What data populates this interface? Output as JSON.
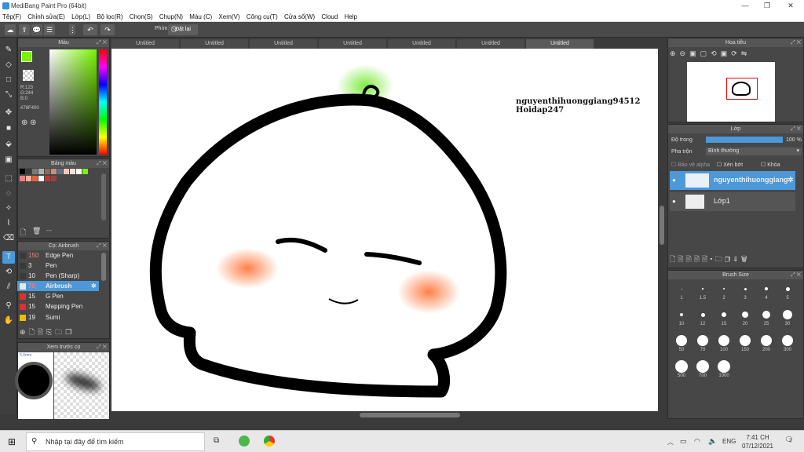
{
  "window": {
    "title": "MediBang Paint Pro (64bit)"
  },
  "menu": [
    "Tệp(F)",
    "Chỉnh sửa(E)",
    "Lớp(L)",
    "Bộ lọc(R)",
    "Chọn(S)",
    "Chụp(N)",
    "Màu (C)",
    "Xem(V)",
    "Công cụ(T)",
    "Cửa sổ(W)",
    "Cloud",
    "Help"
  ],
  "toolbar": {
    "shortcut_label": "Phím",
    "reset_label": "Đặt lại"
  },
  "color_panel": {
    "title": "Màu",
    "r": "R:123",
    "g": "G:244",
    "b": "B:0",
    "hex": "#78F400",
    "fg_color": "#78f400",
    "bg_color": "#000000"
  },
  "palette_panel": {
    "title": "Bảng màu",
    "name": "---"
  },
  "brush_panel": {
    "title": "Cọ: Airbrush",
    "items": [
      {
        "size": "150",
        "name": "Edge Pen",
        "color": "#3a3a3a"
      },
      {
        "size": "3",
        "name": "Pen",
        "color": "#3a3a3a"
      },
      {
        "size": "10",
        "name": "Pen (Sharp)",
        "color": "#3a3a3a"
      },
      {
        "size": "70",
        "name": "Airbrush",
        "color": "#e8e8e8"
      },
      {
        "size": "15",
        "name": "G Pen",
        "color": "#e03030"
      },
      {
        "size": "15",
        "name": "Mapping Pen",
        "color": "#e03030"
      },
      {
        "size": "19",
        "name": "Sumi",
        "color": "#e8c000"
      }
    ]
  },
  "preview_panel": {
    "title": "Xem trước cọ",
    "label": "5.0mm"
  },
  "tabs": [
    "Untitled",
    "Untitled",
    "Untitled",
    "Untitled",
    "Untitled",
    "Untitled",
    "Untitled"
  ],
  "canvas": {
    "watermark_line1": "nguyenthihuonggiang94512",
    "watermark_line2": "Hoidap247"
  },
  "navigator": {
    "title": "Hoa tiêu"
  },
  "layers_panel": {
    "title": "Lớp",
    "opacity_label": "Độ trong",
    "opacity_value": "100 %",
    "opacity_fraction": 1.0,
    "blend_label": "Pha trộn",
    "blend_value": "Bình thường",
    "protect_alpha": "Bảo vệ alpha",
    "clipping": "Xén bớt",
    "lock": "Khóa",
    "layers": [
      {
        "name": "nguyenthihuonggiang",
        "selected": true
      },
      {
        "name": "Lớp1",
        "selected": false
      }
    ]
  },
  "brush_size_panel": {
    "title": "Brush Size",
    "sizes": [
      "1",
      "1.5",
      "2",
      "3",
      "4",
      "5",
      "10",
      "12",
      "15",
      "20",
      "25",
      "30",
      "50",
      "70",
      "100",
      "150",
      "200",
      "300",
      "500",
      "700",
      "1000"
    ]
  },
  "taskbar": {
    "search_placeholder": "Nhập tại đây để tìm kiếm",
    "lang": "ENG",
    "time": "7:41 CH",
    "date": "07/12/2021",
    "notif_count": "2"
  }
}
